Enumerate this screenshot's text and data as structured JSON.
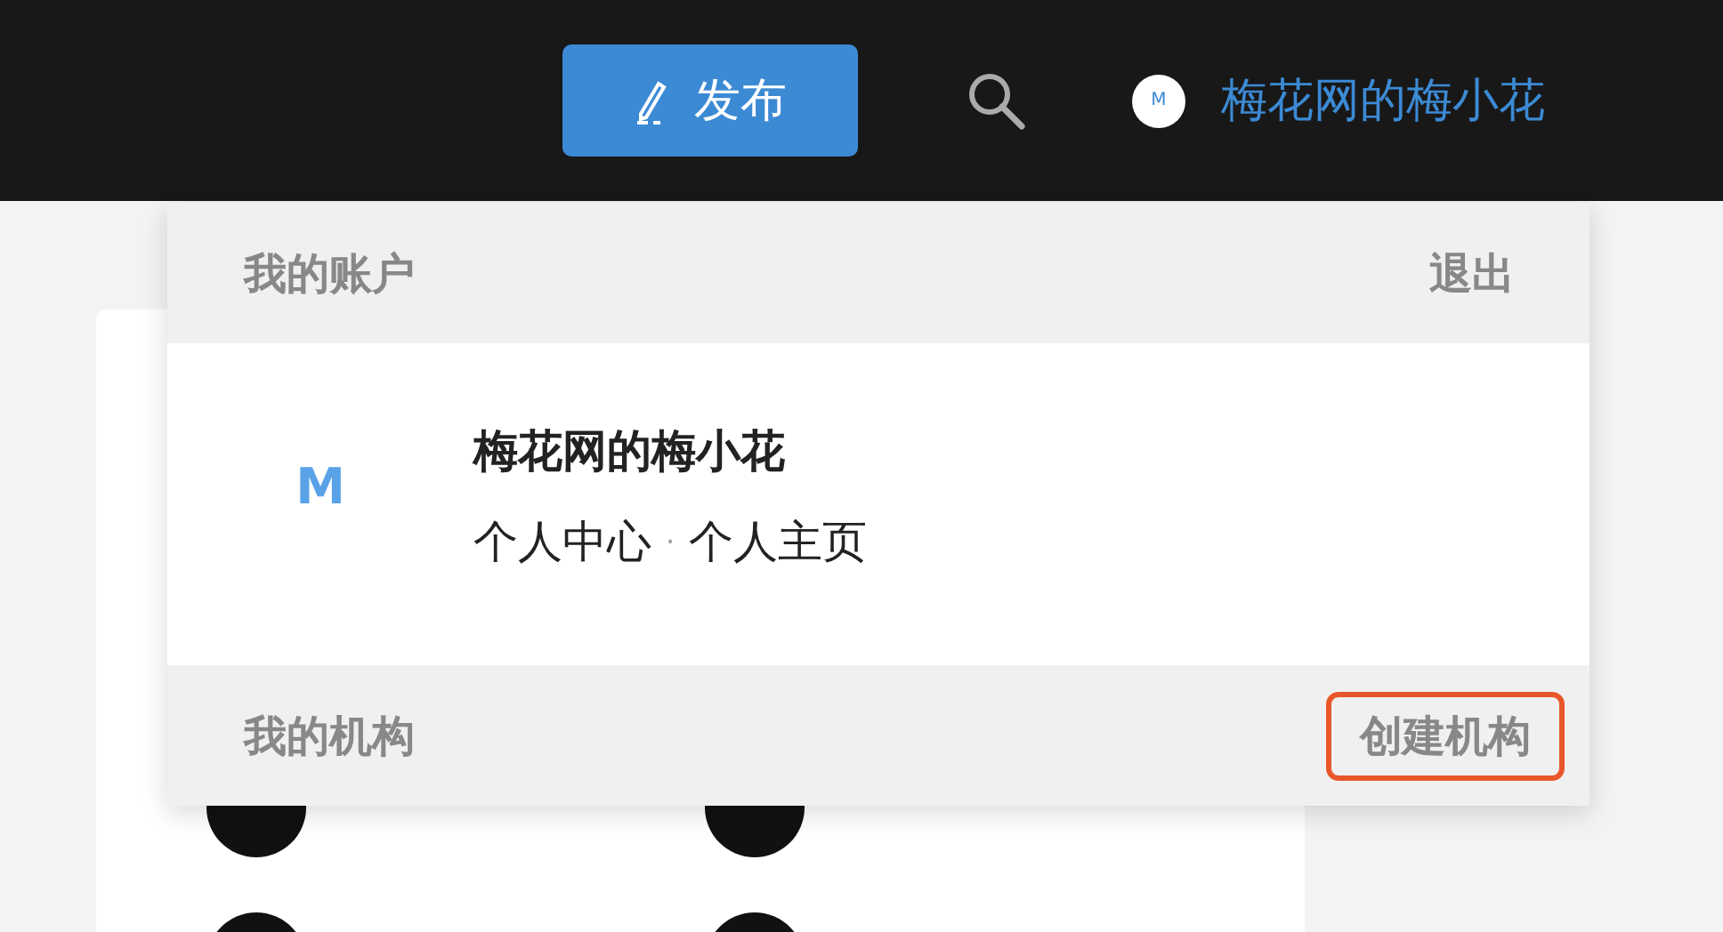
{
  "header": {
    "publish_button": "发布",
    "user_avatar": "M",
    "user_name": "梅花网的梅小花"
  },
  "account_menu": {
    "title": "我的账户",
    "logout": "退出",
    "avatar": "M",
    "name": "梅花网的梅小花",
    "links": [
      "个人中心",
      "个人主页"
    ],
    "separator": "·",
    "org_title": "我的机构",
    "create_org": "创建机构"
  }
}
